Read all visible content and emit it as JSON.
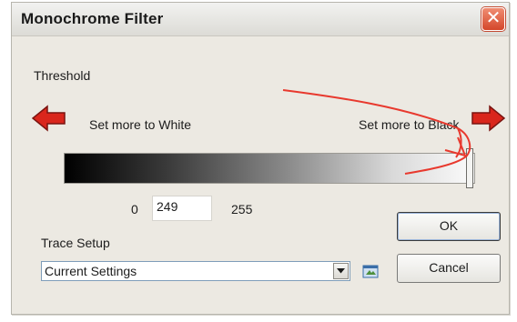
{
  "window": {
    "title": "Monochrome Filter",
    "close_label": "✕"
  },
  "threshold": {
    "label": "Threshold",
    "left_hint": "Set more to White",
    "right_hint": "Set more to Black",
    "min_label": "0",
    "value": "249",
    "max_label": "255",
    "slider_value": 249
  },
  "trace_setup": {
    "label": "Trace Setup",
    "selected": "Current Settings"
  },
  "buttons": {
    "ok": "OK",
    "cancel": "Cancel"
  },
  "icons": {
    "left_arrow": "left-arrow-icon",
    "right_arrow": "right-arrow-icon",
    "dropdown": "chevron-down-icon",
    "setup": "trace-setup-icon"
  },
  "colors": {
    "arrow_fill": "#d9261c",
    "annotation": "#e8392e"
  }
}
